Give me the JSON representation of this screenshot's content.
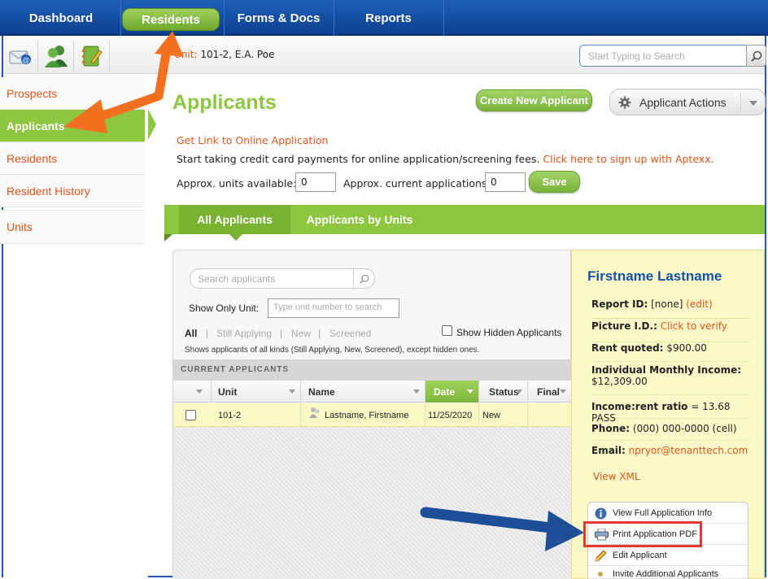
{
  "nav": {
    "tabs": [
      "Dashboard",
      "Residents",
      "Forms & Docs",
      "Reports"
    ],
    "active": "Residents"
  },
  "toolbar": {
    "unit_label": "Unit:",
    "unit_value": "101-2, E.A. Poe",
    "search_placeholder": "Start Typing to Search",
    "icons": [
      "mail-icon",
      "people-icon",
      "notebook-icon"
    ]
  },
  "sidebar": {
    "items": [
      "Prospects",
      "Applicants",
      "Residents",
      "Resident History",
      "Units"
    ],
    "active": "Applicants"
  },
  "main": {
    "title": "Applicants",
    "create_button": "Create New Applicant",
    "actions_button": "Applicant Actions",
    "online_link": "Get Link to Online Application",
    "payments_text": "Start taking credit card payments for online application/screening fees.",
    "payments_link": "Click here to sign up with Aptexx.",
    "units_label": "Approx. units available:",
    "units_value": "0",
    "apps_label": "Approx. current applications:",
    "apps_value": "0",
    "save_button": "Save"
  },
  "tabs": {
    "items": [
      "All Applicants",
      "Applicants by Units"
    ],
    "active": "All Applicants"
  },
  "list": {
    "search_placeholder": "Search applicants",
    "show_only_unit_label": "Show Only Unit:",
    "unit_placeholder": "Type unit number to search",
    "filters": [
      "All",
      "Still Applying",
      "New",
      "Screened"
    ],
    "filter_sep": "|",
    "show_hidden_label": "Show Hidden Applicants",
    "filter_note": "Shows applicants of all kinds (Still Applying, New, Screened), except hidden ones.",
    "section_title": "CURRENT APPLICANTS",
    "columns": [
      "Unit",
      "Name",
      "Date",
      "Status",
      "Final"
    ],
    "rows": [
      {
        "unit": "101-2",
        "name": "Lastname, Firstname",
        "date": "11/25/2020",
        "status": "New",
        "final": ""
      }
    ]
  },
  "detail": {
    "name": "Firstname Lastname",
    "report_id_label": "Report ID:",
    "report_id_value": "[none]",
    "edit_link": "(edit)",
    "picture_label": "Picture I.D.:",
    "picture_link": "Click to verify",
    "rent_label": "Rent quoted:",
    "rent_value": "$900.00",
    "income_label": "Individual Monthly Income:",
    "income_value": "$12,309.00",
    "ratio_label": "Income:rent ratio",
    "ratio_value": "= 13.68 PASS",
    "phone_label": "Phone:",
    "phone_value": "(000) 000-0000 (cell)",
    "email_label": "Email:",
    "email_value": "npryor@tenanttech.com",
    "xml_link": "View XML",
    "menu": [
      "View Full Application Info",
      "Print Application PDF",
      "Edit Applicant",
      "Invite Additional Applicants"
    ]
  },
  "colors": {
    "nav_blue": "#1652a8",
    "accent_green": "#8dc63f",
    "link_orange": "#e0551c",
    "annotation_orange": "#f37021",
    "annotation_blue": "#1d4e96",
    "highlight_red": "#e23a32"
  }
}
